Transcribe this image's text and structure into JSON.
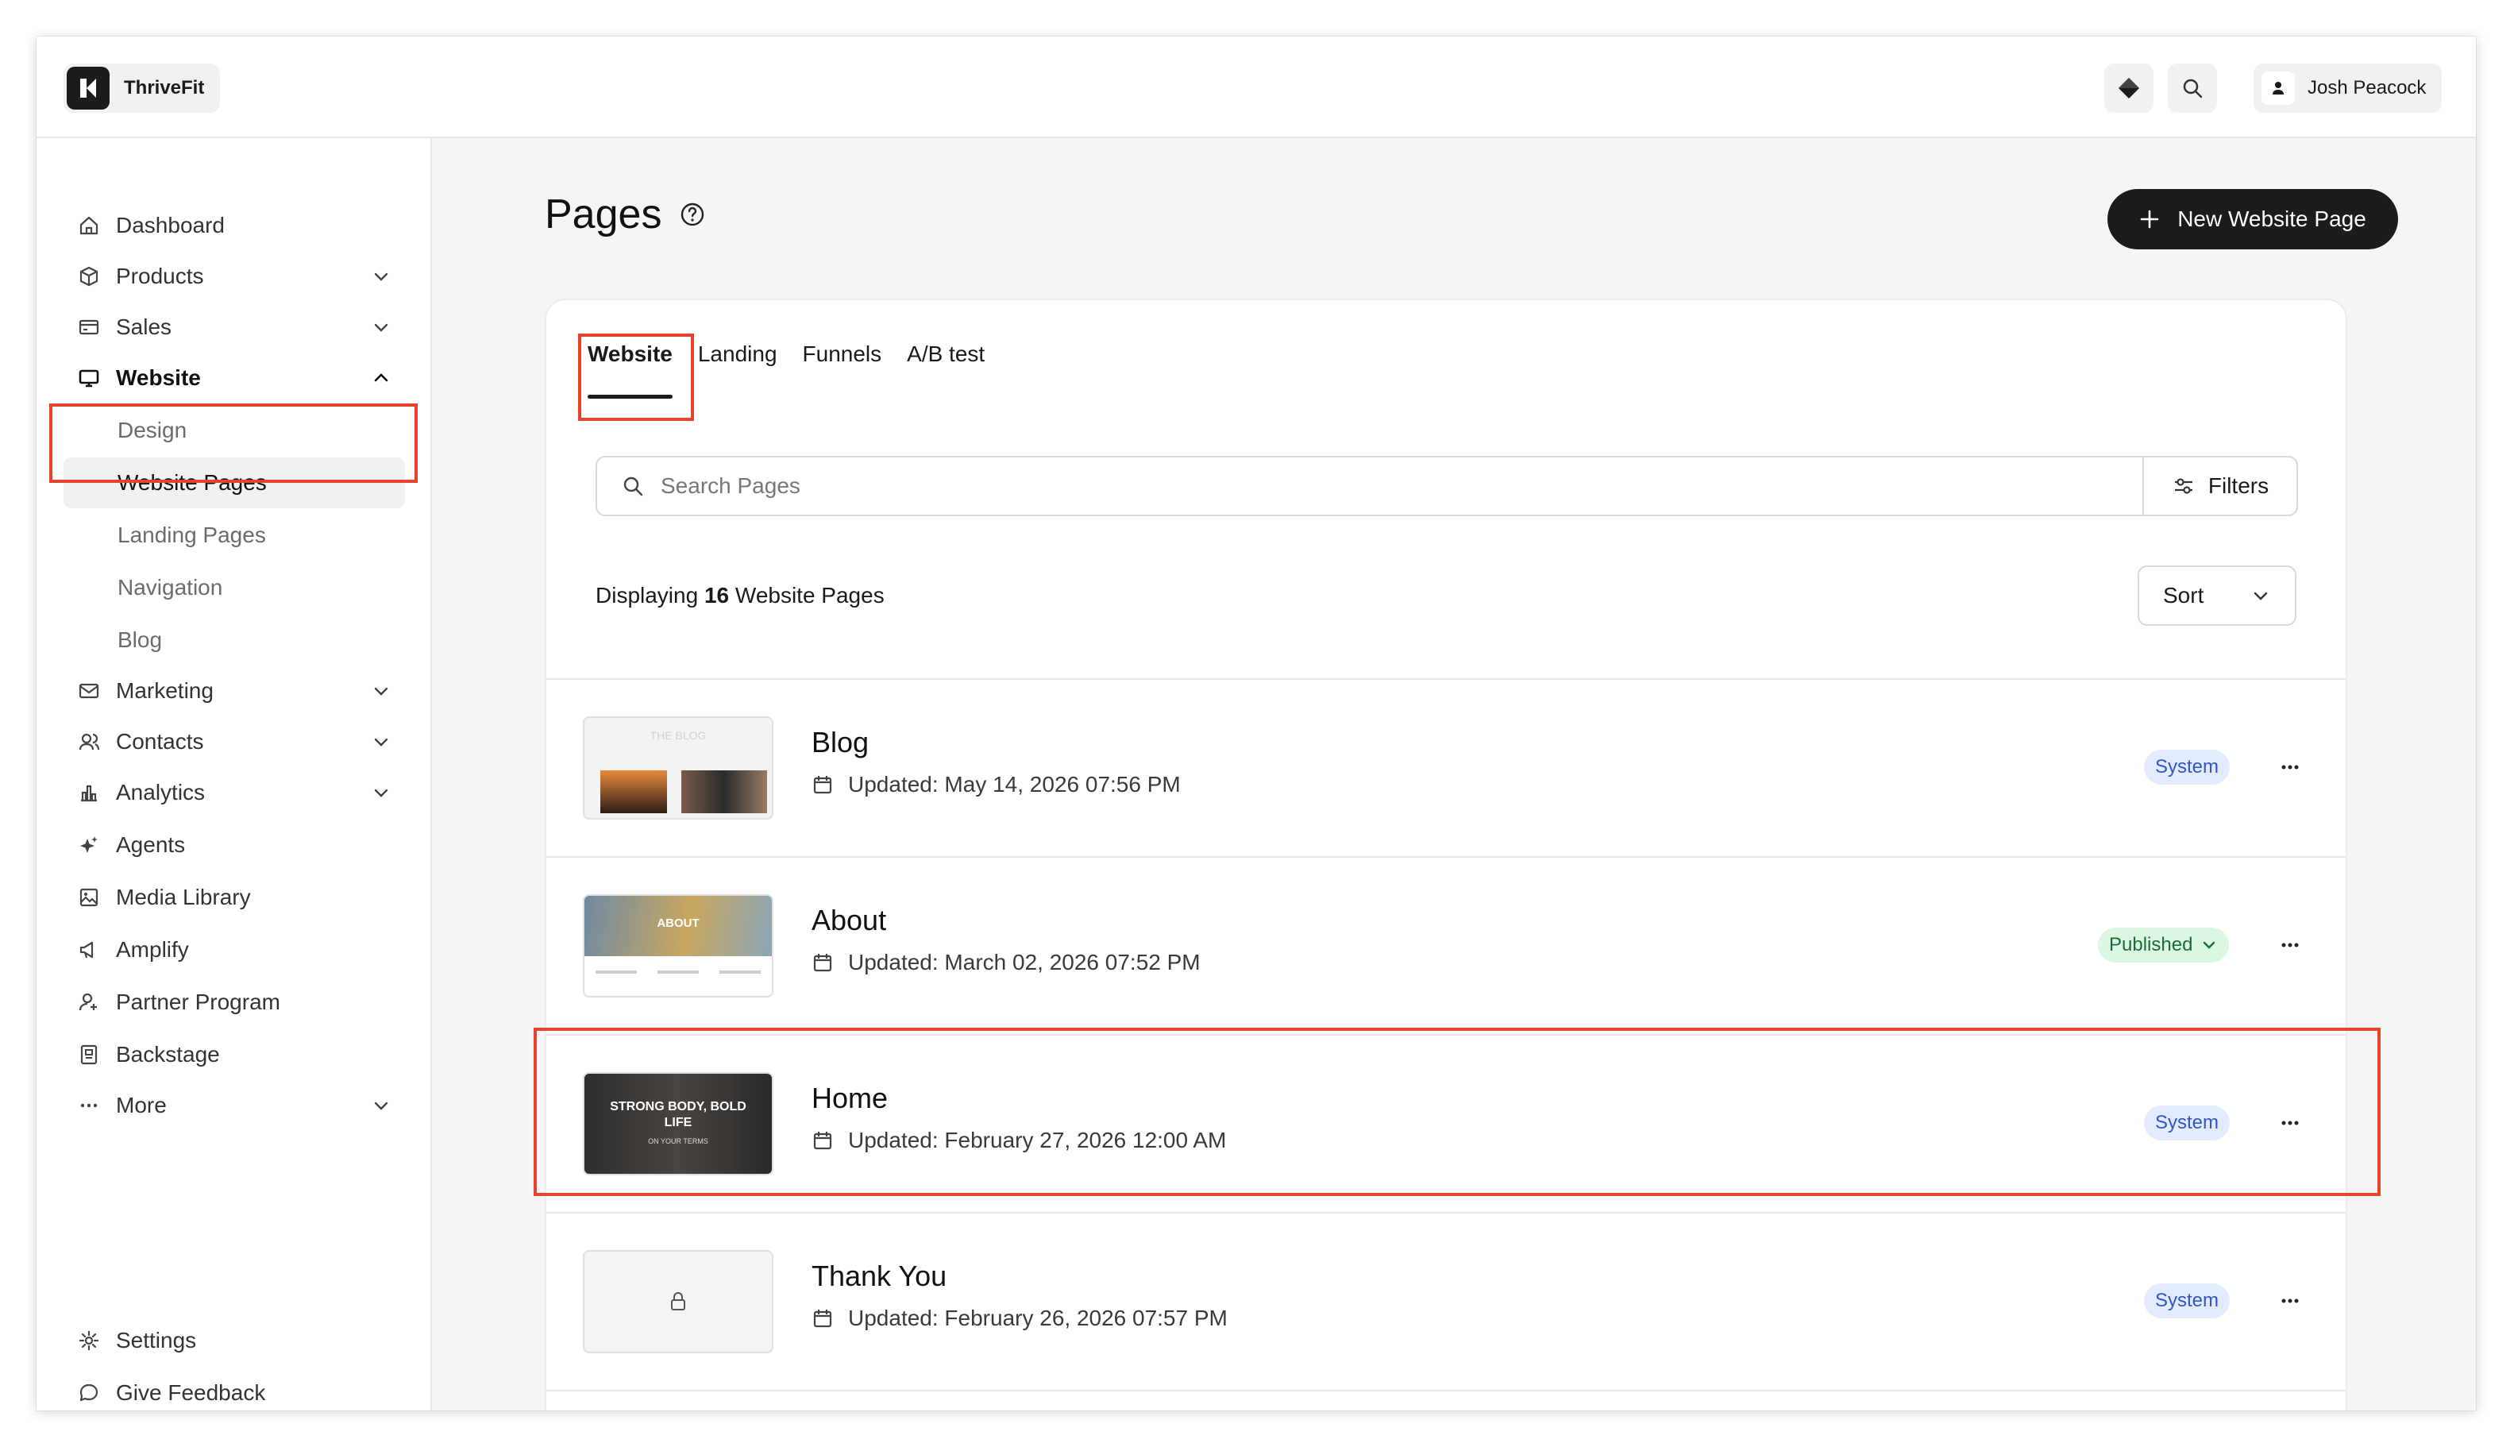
{
  "app": {
    "brand_name": "ThriveFit",
    "user_name": "Josh Peacock"
  },
  "sidebar": {
    "items": [
      {
        "label": "Dashboard",
        "icon": "home-icon"
      },
      {
        "label": "Products",
        "icon": "box-icon"
      },
      {
        "label": "Sales",
        "icon": "card-icon"
      },
      {
        "label": "Website",
        "icon": "monitor-icon"
      },
      {
        "label": "Marketing",
        "icon": "mail-icon"
      },
      {
        "label": "Contacts",
        "icon": "users-icon"
      },
      {
        "label": "Analytics",
        "icon": "bar-chart-icon"
      },
      {
        "label": "Agents",
        "icon": "sparkle-icon"
      },
      {
        "label": "Media Library",
        "icon": "image-icon"
      },
      {
        "label": "Amplify",
        "icon": "megaphone-icon"
      },
      {
        "label": "Partner Program",
        "icon": "partner-icon"
      },
      {
        "label": "Backstage",
        "icon": "backstage-icon"
      },
      {
        "label": "More",
        "icon": "ellipsis-icon"
      }
    ],
    "website_sub": [
      "Design",
      "Website Pages",
      "Landing Pages",
      "Navigation",
      "Blog"
    ],
    "settings_label": "Settings",
    "feedback_label": "Give Feedback"
  },
  "main": {
    "title": "Pages",
    "new_button_label": "New Website Page",
    "tabs": [
      "Website",
      "Landing",
      "Funnels",
      "A/B test"
    ],
    "search_placeholder": "Search Pages",
    "filters_label": "Filters",
    "count_prefix": "Displaying",
    "count_value": "16",
    "count_suffix": "Website Pages",
    "sort_label": "Sort",
    "pages": [
      {
        "title": "Blog",
        "updated": "Updated: May 14, 2026 07:56 PM",
        "status": "System",
        "thumb_text": "THE BLOG"
      },
      {
        "title": "About",
        "updated": "Updated: March 02, 2026 07:52 PM",
        "status": "Published",
        "thumb_text": "ABOUT"
      },
      {
        "title": "Home",
        "updated": "Updated: February 27, 2026 12:00 AM",
        "status": "System",
        "thumb_text": "STRONG BODY, BOLD LIFE",
        "thumb_sub": "ON YOUR TERMS"
      },
      {
        "title": "Thank You",
        "updated": "Updated: February 26, 2026 07:57 PM",
        "status": "System"
      }
    ]
  },
  "colors": {
    "accent_dark": "#1c1c1c",
    "highlight": "#e8412c",
    "system_badge": "#e3ecff",
    "published_badge": "#dcf6e4"
  }
}
